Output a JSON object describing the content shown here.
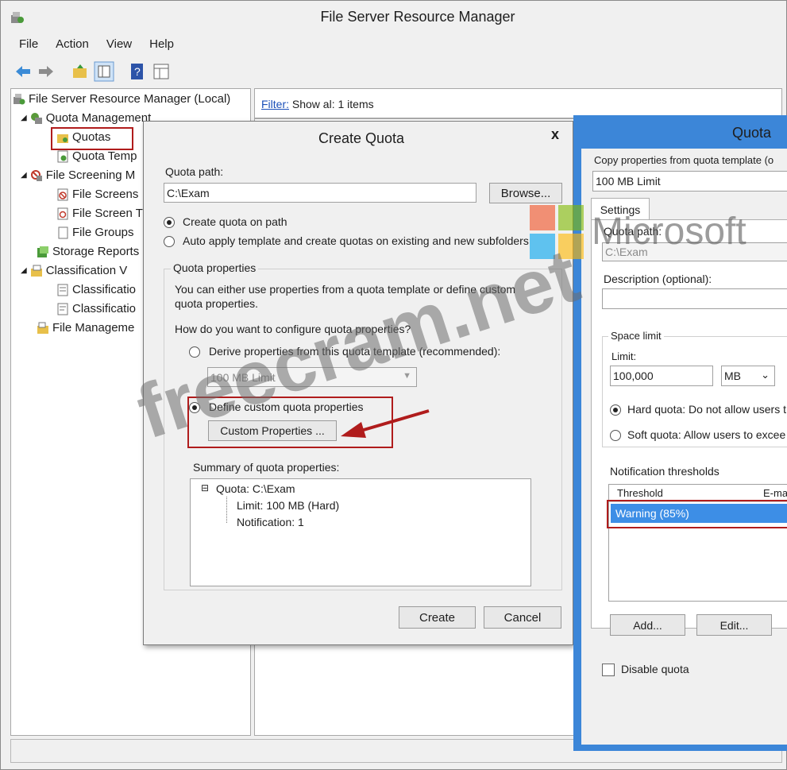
{
  "main_window": {
    "title": "File Server Resource Manager",
    "menu": [
      "File",
      "Action",
      "View",
      "Help"
    ]
  },
  "tree": {
    "root": "File Server Resource Manager (Local)",
    "quota_management": "Quota Management",
    "quotas": "Quotas",
    "quota_templates": "Quota Temp",
    "file_screening": "File Screening M",
    "file_screens": "File Screens",
    "file_screen_templates": "File Screen T",
    "file_groups": "File Groups",
    "storage_reports": "Storage Reports",
    "classification": "Classification V",
    "classification_1": "Classificatio",
    "classification_2": "Classificatio",
    "file_management": "File Manageme"
  },
  "content": {
    "filter_link": "Filter:",
    "filter_text": "Show al: 1 items"
  },
  "create_quota": {
    "title": "Create Quota",
    "close": "x",
    "quota_path_label": "Quota path:",
    "quota_path_value": "C:\\Exam",
    "browse": "Browse...",
    "radio_create": "Create quota on path",
    "radio_auto": "Auto apply template and create quotas on existing and new subfolders",
    "group_label": "Quota properties",
    "description": "You can either use properties from a quota template or define custom quota properties.",
    "question": "How do you want to configure quota properties?",
    "radio_derive": "Derive properties from this quota template (recommended):",
    "template_value": "100 MB Limit",
    "radio_custom": "Define custom quota properties",
    "custom_button": "Custom Properties ...",
    "summary_label": "Summary of quota properties:",
    "summary_root": "Quota: C:\\Exam",
    "summary_limit": "Limit: 100 MB (Hard)",
    "summary_notification": "Notification: 1",
    "create_button": "Create",
    "cancel_button": "Cancel"
  },
  "quota_props": {
    "title": "Quota",
    "copy_label": "Copy properties from quota template (o",
    "copy_value": "100 MB Limit",
    "tab_settings": "Settings",
    "quota_path_label": "Quota path:",
    "quota_path_value": "C:\\Exam",
    "description_label": "Description (optional):",
    "space_limit_label": "Space limit",
    "limit_label": "Limit:",
    "limit_value": "100,000",
    "unit_value": "MB",
    "hard_quota": "Hard quota: Do not allow users t",
    "soft_quota": "Soft quota: Allow users to excee",
    "notification_label": "Notification thresholds",
    "col_threshold": "Threshold",
    "col_email": "E-ma",
    "row_warning": "Warning (85%)",
    "add_button": "Add...",
    "edit_button": "Edit...",
    "disable_quota": "Disable quota"
  },
  "watermark": {
    "brand": "Microsoft",
    "site": "freecram.net"
  },
  "colors": {
    "title_bg": "#f0f0f0",
    "blue_frame": "#3c86d8",
    "highlight": "#3d8ee6",
    "red_box": "#b01c1c",
    "link": "#1a4fb8"
  }
}
